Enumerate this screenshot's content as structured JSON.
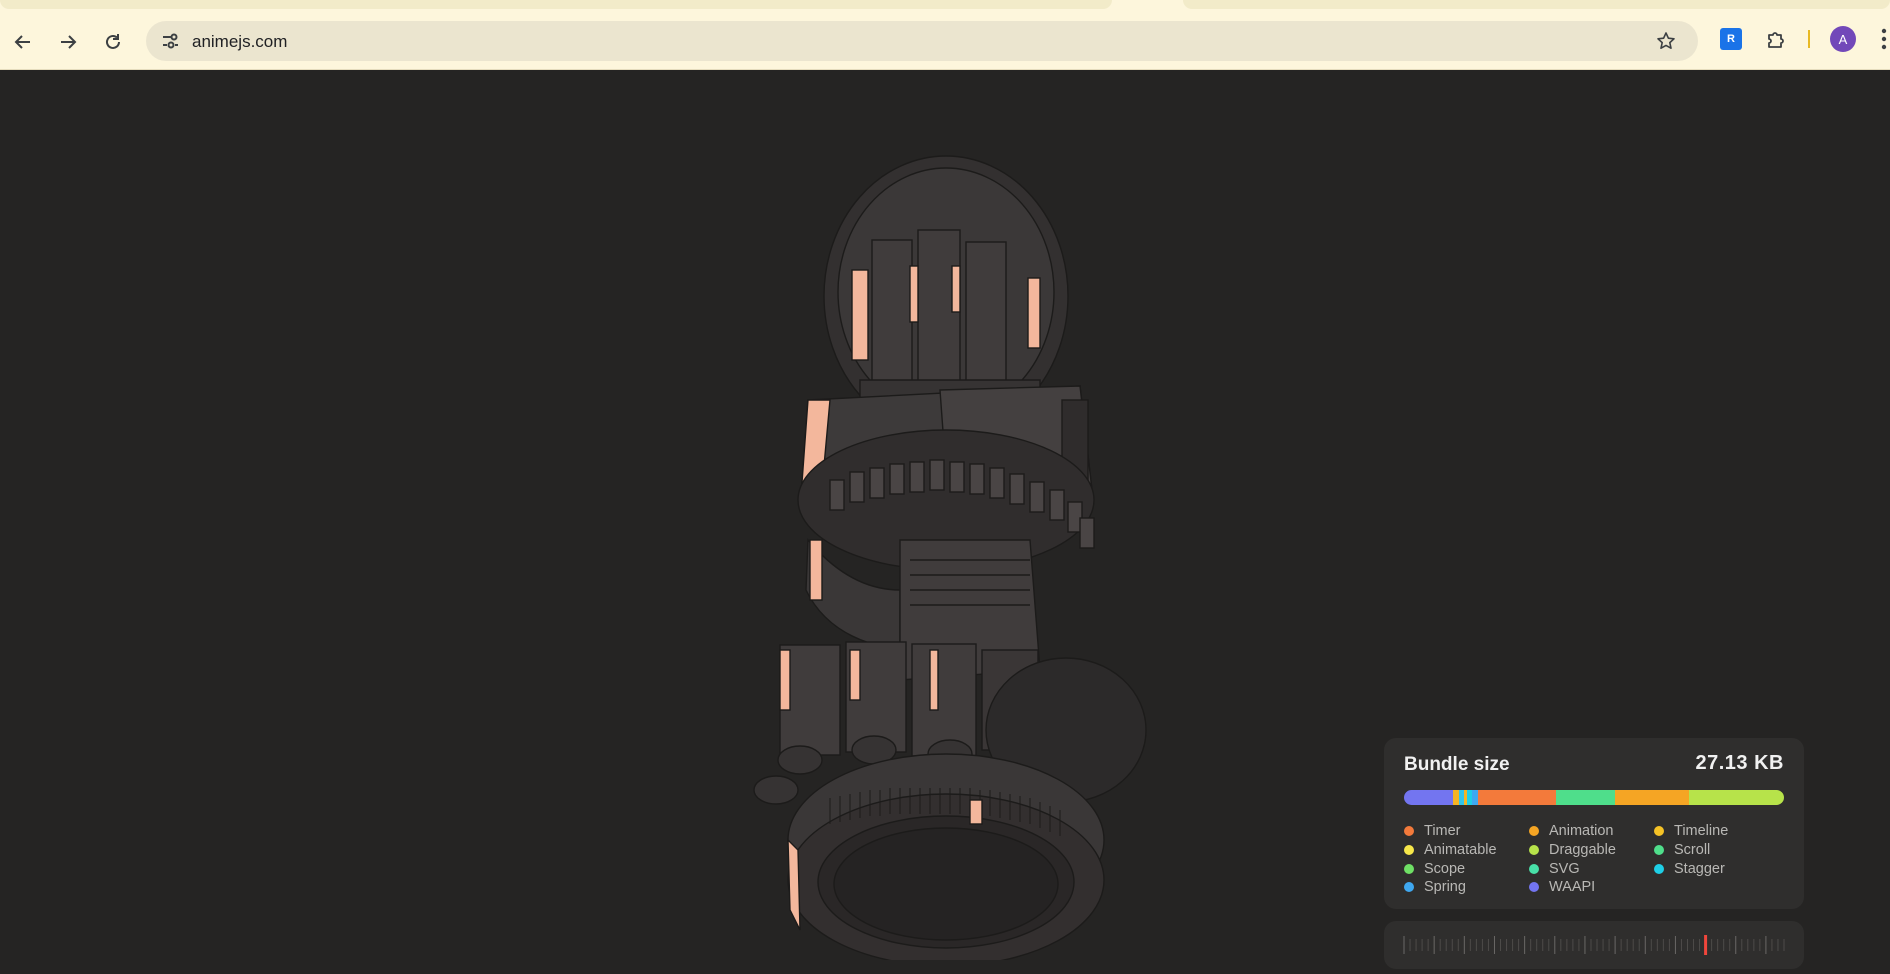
{
  "browser": {
    "url": "animejs.com",
    "extension_badge": "R",
    "profile_initial": "A",
    "icons": [
      "back-arrow-icon",
      "forward-arrow-icon",
      "reload-icon",
      "site-info-icon",
      "star-icon",
      "puzzle-icon",
      "more-vert-icon"
    ]
  },
  "bundle": {
    "title": "Bundle size",
    "value": "27.13 KB",
    "bar_segments": [
      {
        "color": "#7375f0",
        "fraction": 0.128
      },
      {
        "color": "#f5b423",
        "fraction": 0.018
      },
      {
        "color": "#31c5ea",
        "fraction": 0.012
      },
      {
        "color": "#f5b423",
        "fraction": 0.008
      },
      {
        "color": "#1fcfe6",
        "fraction": 0.012
      },
      {
        "color": "#3fa8f0",
        "fraction": 0.016
      },
      {
        "color": "#f37a3b",
        "fraction": 0.206
      },
      {
        "color": "#4fde8b",
        "fraction": 0.156
      },
      {
        "color": "#f5a524",
        "fraction": 0.194
      },
      {
        "color": "#b7e34a",
        "fraction": 0.25
      }
    ],
    "legend": [
      {
        "label": "Timer",
        "color": "#f37a3b"
      },
      {
        "label": "Animation",
        "color": "#f5a524"
      },
      {
        "label": "Timeline",
        "color": "#f5c226"
      },
      {
        "label": "Animatable",
        "color": "#f7e84a"
      },
      {
        "label": "Draggable",
        "color": "#b7e34a"
      },
      {
        "label": "Scroll",
        "color": "#4fde8b"
      },
      {
        "label": "Scope",
        "color": "#6fe065"
      },
      {
        "label": "SVG",
        "color": "#48e0a8"
      },
      {
        "label": "Stagger",
        "color": "#1fcfe6"
      },
      {
        "label": "Spring",
        "color": "#3fa8f0"
      },
      {
        "label": "WAAPI",
        "color": "#7375f0"
      }
    ]
  },
  "timeline": {
    "tick_count": 64,
    "active_tick": 50,
    "active_color": "#f0463c"
  }
}
